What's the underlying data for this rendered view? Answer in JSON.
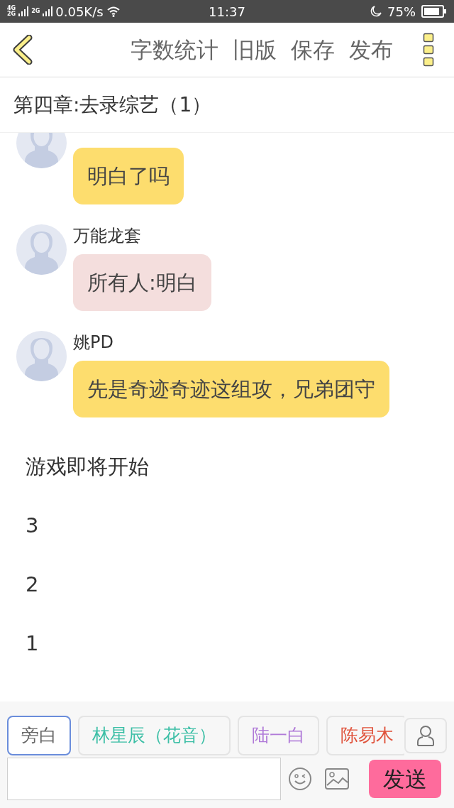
{
  "status_bar": {
    "network_labels": [
      "4G",
      "2G",
      "2G"
    ],
    "speed": "0.05K/s",
    "time": "11:37",
    "battery": "75%"
  },
  "toolbar": {
    "actions": [
      "字数统计",
      "旧版",
      "保存",
      "发布"
    ]
  },
  "chapter_title": "第四章:去录综艺（1）",
  "messages": [
    {
      "kind": "bubble",
      "text": "明白了吗",
      "color": "#fddd6e"
    },
    {
      "kind": "bubble",
      "name": "万能龙套",
      "text": "所有人:明白",
      "color": "#f4dedd"
    },
    {
      "kind": "bubble",
      "name": "姚PD",
      "text": "先是奇迹奇迹这组攻，兄弟团守",
      "color": "#fddd6e"
    },
    {
      "kind": "narration",
      "text": "游戏即将开始"
    },
    {
      "kind": "narration",
      "text": "3"
    },
    {
      "kind": "narration",
      "text": "2"
    },
    {
      "kind": "narration",
      "text": "1"
    }
  ],
  "characters": [
    {
      "label": "旁白",
      "color": "#666666",
      "selected": true
    },
    {
      "label": "林星辰（花音）",
      "color": "#3cbfa6",
      "selected": false
    },
    {
      "label": "陆一白",
      "color": "#b07ad8",
      "selected": false
    },
    {
      "label": "陈易木",
      "color": "#e0533c",
      "selected": false
    }
  ],
  "send_button": "发送"
}
